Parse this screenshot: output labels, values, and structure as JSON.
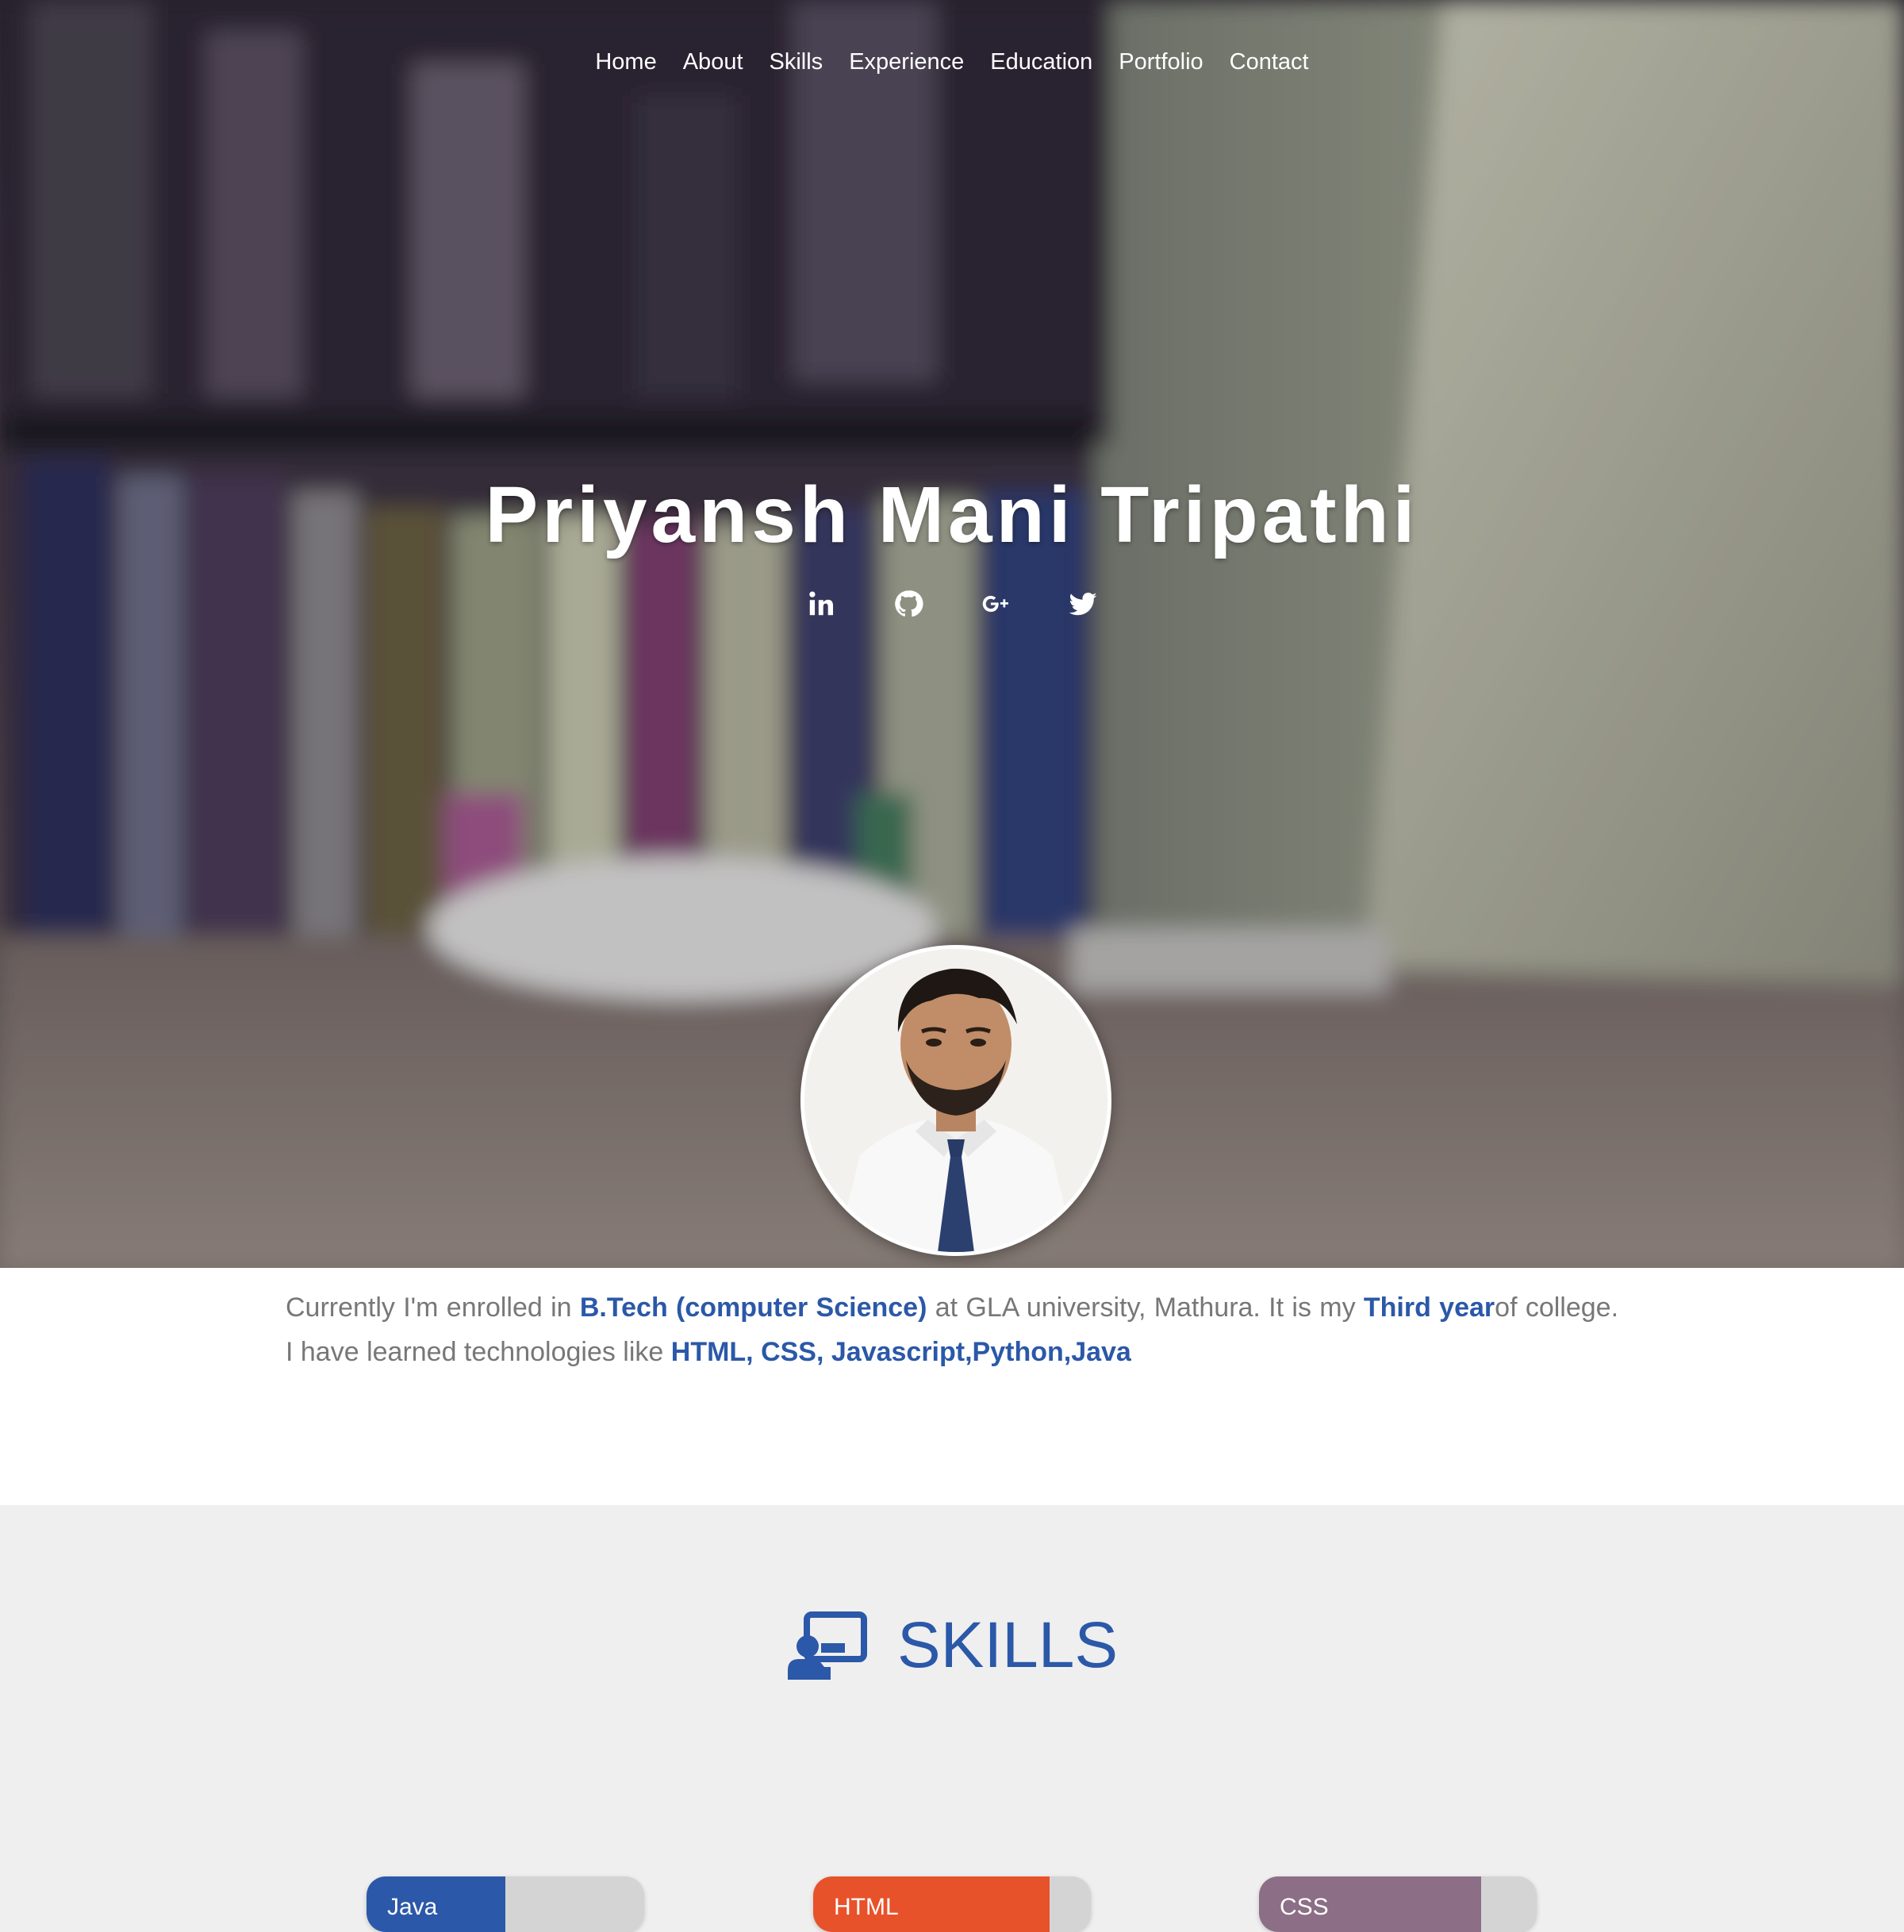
{
  "nav": {
    "items": [
      "Home",
      "About",
      "Skills",
      "Experience",
      "Education",
      "Portfolio",
      "Contact"
    ]
  },
  "hero": {
    "name": "Priyansh Mani Tripathi",
    "social_icons": [
      "linkedin-icon",
      "github-icon",
      "google-plus-icon",
      "twitter-icon"
    ]
  },
  "about": {
    "t1": "Currently I'm enrolled in ",
    "b1": "B.Tech (computer Science)",
    "t2": " at GLA university, Mathura. It is my ",
    "b2": "Third year",
    "t3": "of college. I have learned technologies like ",
    "b3": "HTML, CSS, Javascript,Python,Java"
  },
  "skills": {
    "heading": "SKILLS",
    "icon": "teacher-board-icon",
    "items": [
      {
        "label": "Java",
        "level": 0.5,
        "color": "#2b58a8"
      },
      {
        "label": "HTML",
        "level": 0.85,
        "color": "#e8522a"
      },
      {
        "label": "CSS",
        "level": 0.8,
        "color": "#8c6e86"
      }
    ]
  },
  "colors": {
    "accent": "#2b58a8",
    "about_text": "#777777",
    "skills_bg": "#efefef"
  }
}
